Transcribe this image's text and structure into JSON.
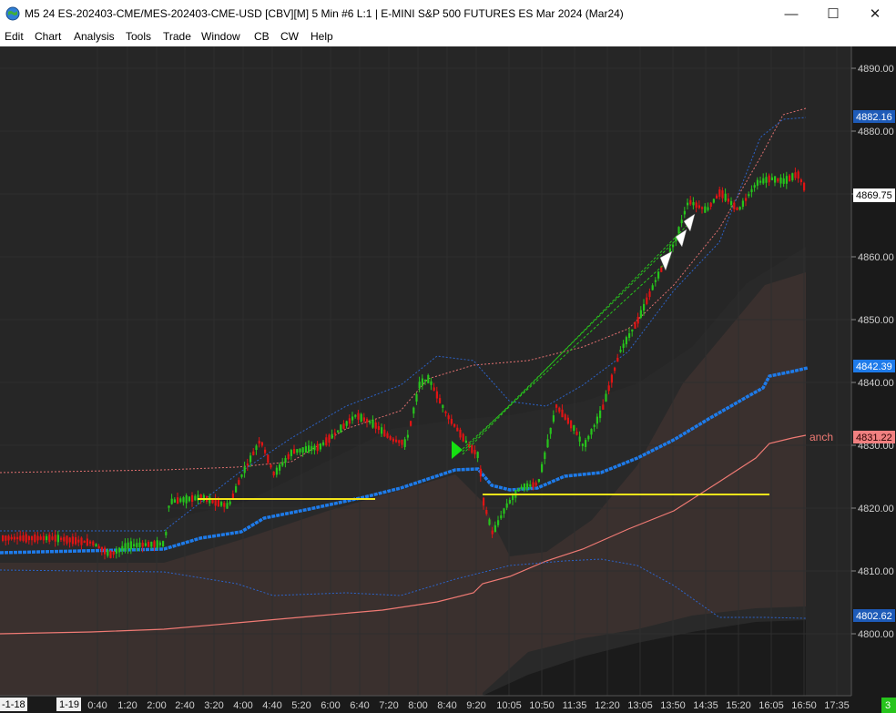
{
  "window": {
    "title": "M5 24 ES-202403-CME/MES-202403-CME-USD [CBV][M]  5 Min  #6 L:1 | E-MINI S&P 500 FUTURES ES Mar 2024 (Mar24)",
    "minimize": "—",
    "maximize": "☐",
    "close": "✕"
  },
  "menu": {
    "items": [
      "Edit",
      "Chart",
      "Analysis",
      "Tools",
      "Trade",
      "Window",
      "CB",
      "CW",
      "Help"
    ]
  },
  "price_axis": {
    "ticks": [
      "4890.00",
      "4880.00",
      "4870.00",
      "4860.00",
      "4850.00",
      "4840.00",
      "4830.00",
      "4820.00",
      "4810.00",
      "4800.00"
    ],
    "badges": {
      "upper_band": "4882.16",
      "last_price": "4869.75",
      "vwap": "4842.39",
      "anchored": "4831.22",
      "lower_band": "4802.62"
    }
  },
  "time_axis": {
    "date_start": "-1-18",
    "date_next": "1-19",
    "ticks": [
      "0:40",
      "1:20",
      "2:00",
      "2:40",
      "3:20",
      "4:00",
      "4:40",
      "5:20",
      "6:00",
      "6:40",
      "7:20",
      "8:00",
      "8:40",
      "9:20",
      "10:05",
      "10:50",
      "11:35",
      "12:20",
      "13:05",
      "13:50",
      "14:35",
      "15:20",
      "16:05",
      "16:50",
      "17:35"
    ],
    "corner_badge": "3"
  },
  "annotations": {
    "anchored_label": "anch"
  },
  "colors": {
    "background": "#1e1e1e",
    "up_candle": "#27c41c",
    "down_candle": "#e01414",
    "vwap_line": "#1e7bea",
    "band_line": "#2c63c9",
    "anchored_line": "#f07a74",
    "level_line": "#f2e41a",
    "signal_arrow": "#15e011",
    "badge_last": "#ffffff",
    "badge_vwap": "#1e7bea",
    "badge_band": "#1e5bb8",
    "badge_anch": "#f08080",
    "badge_corner": "#27c41c"
  },
  "chart_data": {
    "type": "candlestick",
    "y_range": [
      4791,
      4893
    ],
    "horizontal_levels": [
      {
        "price": 4821.5,
        "from_time": "2:40",
        "to_time": "7:00"
      },
      {
        "price": 4822.2,
        "from_time": "9:30",
        "to_time": "16:05"
      }
    ],
    "signals": [
      {
        "kind": "long-entry",
        "time": "8:50",
        "price": 4829.5
      },
      {
        "kind": "exit",
        "time": "13:35",
        "price": 4859.5
      },
      {
        "kind": "exit",
        "time": "13:45",
        "price": 4863.0
      },
      {
        "kind": "exit",
        "time": "13:50",
        "price": 4865.0
      }
    ]
  }
}
